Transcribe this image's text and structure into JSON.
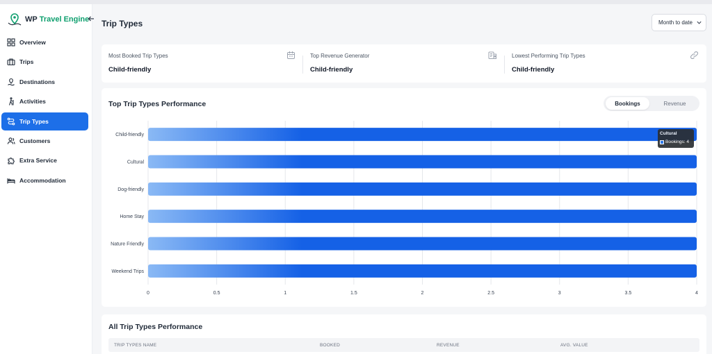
{
  "brand": {
    "prefix": "WP",
    "name": "Travel Engine",
    "color": "#0e9f6e"
  },
  "sidebar": {
    "items": [
      {
        "label": "Overview",
        "icon": "grid-icon"
      },
      {
        "label": "Trips",
        "icon": "suitcase-icon"
      },
      {
        "label": "Destinations",
        "icon": "map-pin-icon"
      },
      {
        "label": "Activities",
        "icon": "hiking-icon"
      },
      {
        "label": "Trip Types",
        "icon": "route-icon",
        "active": true
      },
      {
        "label": "Customers",
        "icon": "users-icon"
      },
      {
        "label": "Extra Service",
        "icon": "puzzle-icon"
      },
      {
        "label": "Accommodation",
        "icon": "bed-icon"
      }
    ],
    "active_color": "#1d6fe8"
  },
  "header": {
    "title": "Trip Types",
    "date_filter": "Month to date"
  },
  "summary": [
    {
      "label": "Most Booked Trip Types",
      "value": "Child-friendly",
      "icon": "calendar-icon"
    },
    {
      "label": "Top Revenue Generator",
      "value": "Child-friendly",
      "icon": "money-icon"
    },
    {
      "label": "Lowest Performing Trip Types",
      "value": "Child-friendly",
      "icon": "link-icon"
    }
  ],
  "performance": {
    "title": "Top Trip Types Performance",
    "toggle": {
      "bookings": "Bookings",
      "revenue": "Revenue",
      "selected": "Bookings"
    },
    "tooltip": {
      "title": "Cultural",
      "label": "Bookings",
      "value": "4"
    }
  },
  "chart_data": {
    "type": "bar",
    "orientation": "horizontal",
    "categories": [
      "Child-friendly",
      "Cultural",
      "Dog-friendly",
      "Home Stay",
      "Nature Friendly",
      "Weekend Trips"
    ],
    "series": [
      {
        "name": "Bookings",
        "values": [
          4,
          4,
          4,
          4,
          4,
          4
        ]
      }
    ],
    "xlim": [
      0,
      4
    ],
    "xticks": [
      "0",
      "0.5",
      "1",
      "1.5",
      "2",
      "2.5",
      "3",
      "3.5",
      "4"
    ],
    "grid": true,
    "colors": {
      "bar_start": "#8ab9f5",
      "bar_end": "#1561e6"
    }
  },
  "all_types": {
    "title": "All Trip Types Performance",
    "columns": [
      "TRIP TYPES NAME",
      "BOOKED",
      "REVENUE",
      "AVG. VALUE"
    ]
  }
}
